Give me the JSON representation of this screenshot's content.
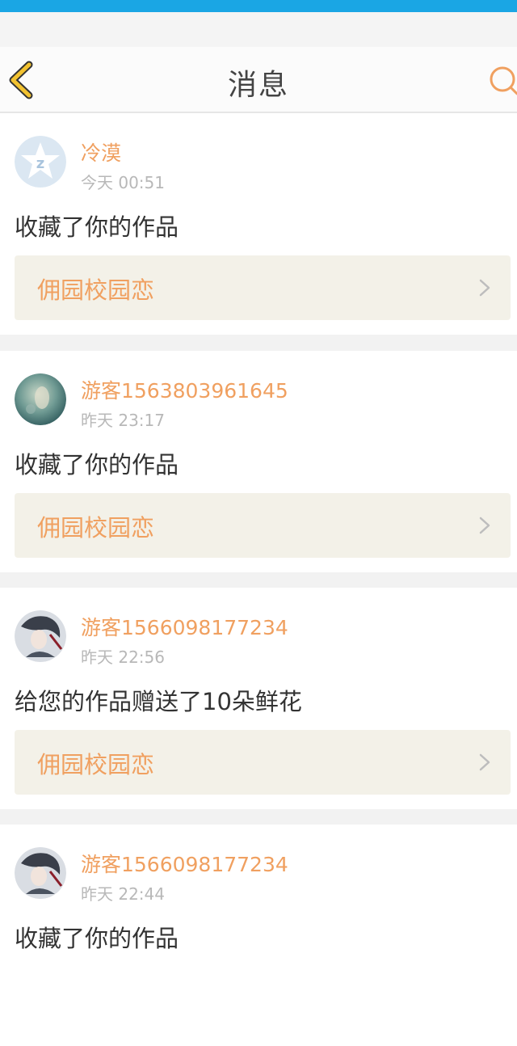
{
  "header": {
    "title": "消息",
    "back_icon": "chevron-left-icon",
    "search_icon": "search-icon"
  },
  "colors": {
    "status_bar": "#1aa6e4",
    "accent": "#f0a060",
    "back_icon": "#f2c230",
    "work_link_bg": "#f3f1e8"
  },
  "messages": [
    {
      "username": "冷漠",
      "time": "今天 00:51",
      "action": "收藏了你的作品",
      "work_title": "佣园校园恋",
      "avatar": "qq-default-avatar"
    },
    {
      "username": "游客1563803961645",
      "time": "昨天 23:17",
      "action": "收藏了你的作品",
      "work_title": "佣园校园恋",
      "avatar": "photo-avatar"
    },
    {
      "username": "游客1566098177234",
      "time": "昨天 22:56",
      "action": "给您的作品赠送了10朵鲜花",
      "work_title": "佣园校园恋",
      "avatar": "anime-avatar"
    },
    {
      "username": "游客1566098177234",
      "time": "昨天 22:44",
      "action": "收藏了你的作品",
      "avatar": "anime-avatar"
    }
  ]
}
